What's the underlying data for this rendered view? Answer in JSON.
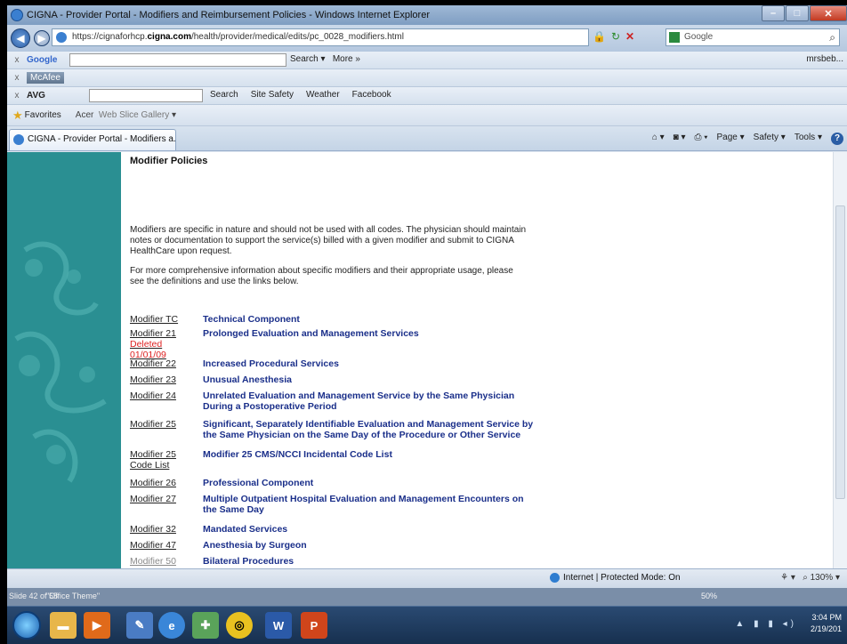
{
  "window": {
    "title": "CIGNA - Provider Portal - Modifiers and Reimbursement Policies - Windows Internet Explorer"
  },
  "address_bar": {
    "url_prefix": "https://cignaforhcp.",
    "url_domain": "cigna.com",
    "url_path": "/health/provider/medical/edits/pc_0028_modifiers.html",
    "search_engine": "Google"
  },
  "google_toolbar": {
    "label": "Google",
    "search": "Search",
    "more": "More »",
    "user": "mrsbeb..."
  },
  "mcafee_toolbar": {
    "label": "McAfee"
  },
  "avg_toolbar": {
    "label": "AVG",
    "items": [
      "Search",
      "Site Safety",
      "Weather",
      "Facebook"
    ]
  },
  "favorites_bar": {
    "favorites": "Favorites",
    "acer": "Acer",
    "web_slice": "Web Slice Gallery"
  },
  "tab": {
    "label": "CIGNA - Provider Portal - Modifiers a..."
  },
  "command_bar": {
    "page": "Page",
    "safety": "Safety",
    "tools": "Tools"
  },
  "content": {
    "heading": "Modifier Policies",
    "paragraph1": "Modifiers are specific in nature and should not be used with all codes. The physician should maintain notes or documentation to support the service(s) billed with a given modifier and submit to CIGNA HealthCare upon request.",
    "paragraph2": "For more comprehensive information about specific modifiers and their appropriate usage, please see the definitions and use the links below.",
    "modifiers": [
      {
        "code": "Modifier TC",
        "desc": "Technical Component"
      },
      {
        "code": "Modifier 21",
        "deleted": "Deleted 01/01/09",
        "desc": "Prolonged Evaluation and Management Services"
      },
      {
        "code": "Modifier 22",
        "desc": "Increased Procedural Services"
      },
      {
        "code": "Modifier 23",
        "desc": "Unusual Anesthesia"
      },
      {
        "code": "Modifier 24",
        "desc": "Unrelated Evaluation and Management Service by the Same Physician During a Postoperative Period"
      },
      {
        "code": "Modifier 25",
        "desc": "Significant, Separately Identifiable Evaluation and Management Service by the Same Physician on the Same Day of the Procedure or Other Service"
      },
      {
        "code": "Modifier 25 Code List",
        "desc": "Modifier 25 CMS/NCCI Incidental Code List"
      },
      {
        "code": "Modifier 26",
        "desc": "Professional Component"
      },
      {
        "code": "Modifier 27",
        "desc": "Multiple Outpatient Hospital Evaluation and Management Encounters on the Same Day"
      },
      {
        "code": "Modifier 32",
        "desc": "Mandated Services"
      },
      {
        "code": "Modifier 47",
        "desc": "Anesthesia by Surgeon"
      },
      {
        "code": "Modifier 50",
        "desc": "Bilateral Procedures"
      }
    ]
  },
  "status_bar": {
    "zone": "Internet | Protected Mode: On",
    "zoom": "130%"
  },
  "ppt_status": {
    "slide": "Slide 42 of 55",
    "theme": "\"Office Theme\"",
    "zoom": "50%"
  },
  "taskbar": {
    "time": "3:04 PM",
    "date": "2/19/201"
  },
  "colors": {
    "link_blue": "#1a2f8a",
    "deleted_red": "#dd2222",
    "sidebar_teal": "#2a8f92"
  }
}
